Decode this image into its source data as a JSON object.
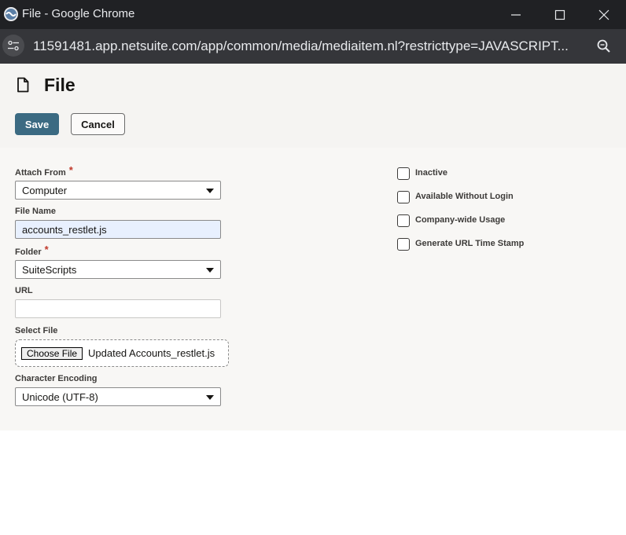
{
  "window": {
    "title": "File - Google Chrome",
    "url": "11591481.app.netsuite.com/app/common/media/mediaitem.nl?restricttype=JAVASCRIPT..."
  },
  "page": {
    "title": "File",
    "save_label": "Save",
    "cancel_label": "Cancel"
  },
  "form": {
    "attach_from": {
      "label": "Attach From",
      "value": "Computer",
      "required": "*"
    },
    "file_name": {
      "label": "File Name",
      "value": "accounts_restlet.js"
    },
    "folder": {
      "label": "Folder",
      "value": "SuiteScripts",
      "required": "*"
    },
    "url": {
      "label": "URL",
      "value": ""
    },
    "select_file": {
      "label": "Select File",
      "button": "Choose File",
      "chosen": "Updated Accounts_restlet.js"
    },
    "encoding": {
      "label": "Character Encoding",
      "value": "Unicode (UTF-8)"
    }
  },
  "checkboxes": [
    {
      "label": "Inactive"
    },
    {
      "label": "Available Without Login"
    },
    {
      "label": "Company-wide Usage"
    },
    {
      "label": "Generate URL Time Stamp"
    }
  ],
  "colors": {
    "titlebar": "#202124",
    "addressbar": "#35363a",
    "save_button": "#3b6a82",
    "required": "#c0392b",
    "autofill": "#e8f0fe"
  },
  "icons": {
    "app": "chrome-app-icon",
    "minimize": "minimize-icon",
    "maximize": "maximize-icon",
    "close": "close-icon",
    "site_info": "site-info-icon",
    "zoom": "zoom-icon",
    "page": "file-icon"
  }
}
